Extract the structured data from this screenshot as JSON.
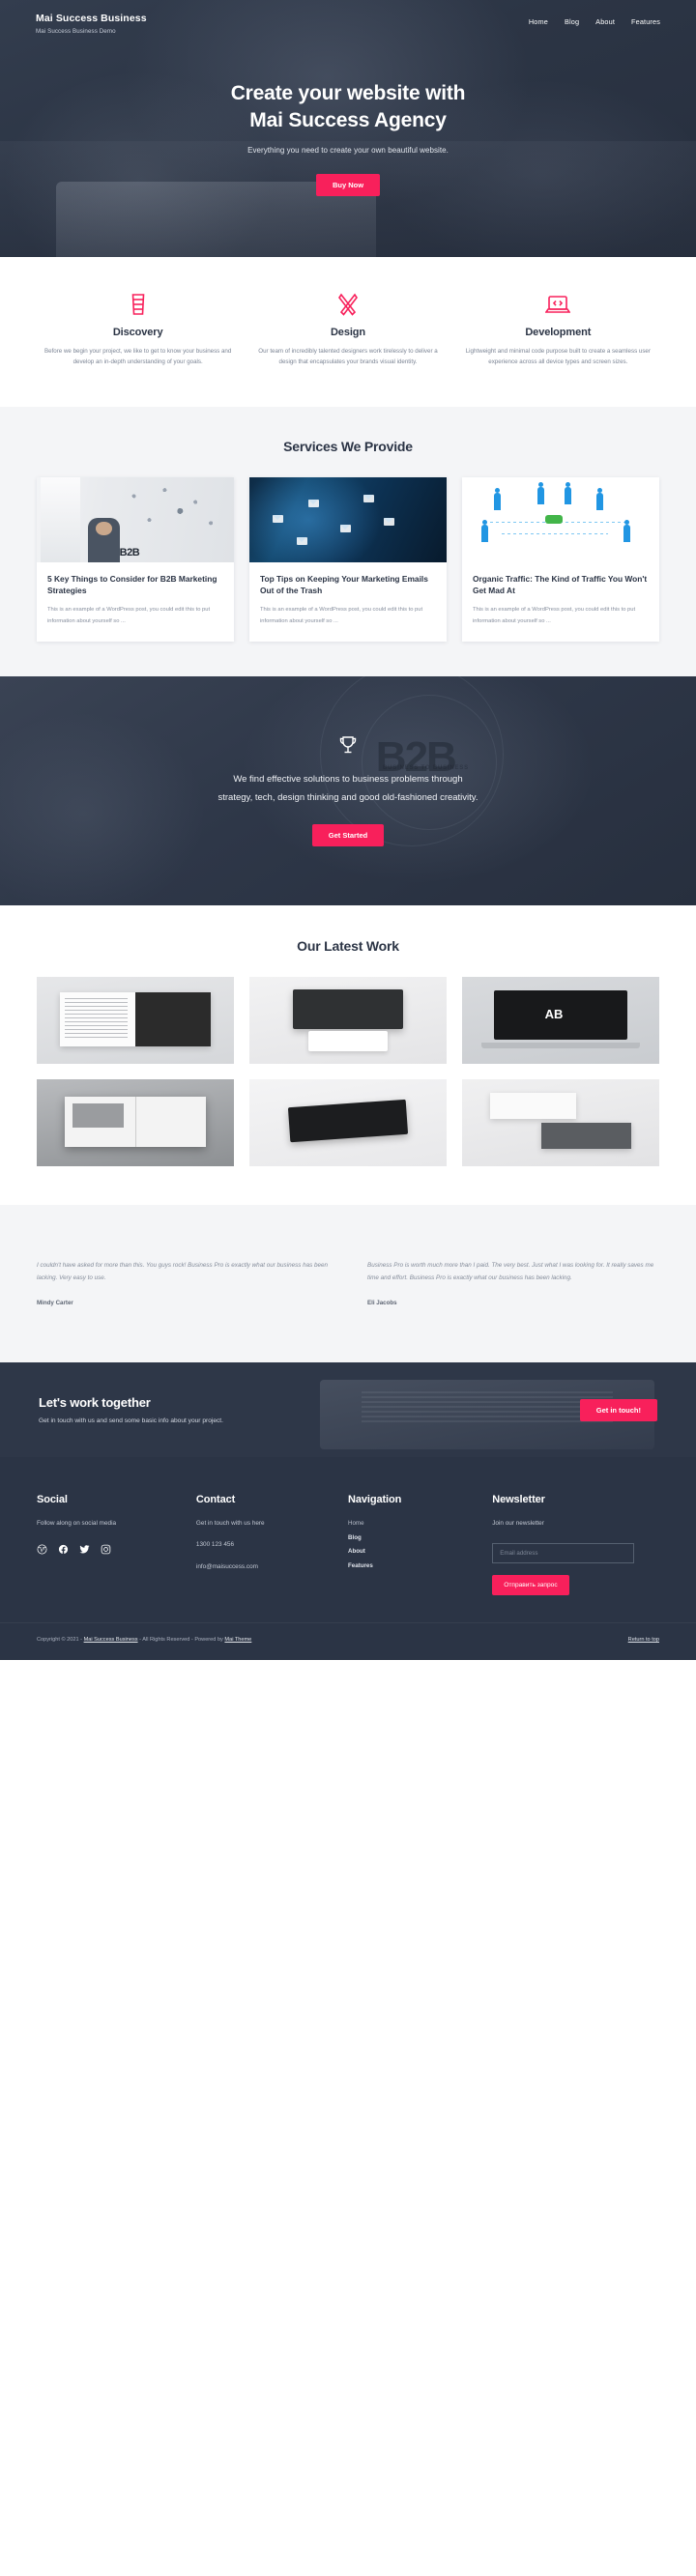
{
  "header": {
    "brand_title": "Mai Success Business",
    "brand_subtitle": "Mai Success Business Demo",
    "nav": [
      {
        "label": "Home"
      },
      {
        "label": "Blog"
      },
      {
        "label": "About"
      },
      {
        "label": "Features"
      }
    ]
  },
  "hero": {
    "title_line1": "Create your website with",
    "title_line2": "Mai Success Agency",
    "subtitle": "Everything you need to create your own beautiful website.",
    "button_label": "Buy Now"
  },
  "features": [
    {
      "icon": "coffee-cup-icon",
      "title": "Discovery",
      "text": "Before we begin your project, we like to get to know your business and develop an in-depth understanding of your goals."
    },
    {
      "icon": "pencil-ruler-icon",
      "title": "Design",
      "text": "Our team of incredibly talented designers work tirelessly to deliver a design that encapsulates your brands visual identity."
    },
    {
      "icon": "laptop-code-icon",
      "title": "Development",
      "text": "Lightweight and minimal code purpose built to create a seamless user experience across all device types and screen sizes."
    }
  ],
  "services": {
    "title": "Services We Provide",
    "cards": [
      {
        "image": "b2b-meeting-photo",
        "title": "5 Key Things to Consider for B2B Marketing Strategies",
        "text": "This is an example of a WordPress post, you could edit this to put information about yourself so ..."
      },
      {
        "image": "email-marketing-photo",
        "title": "Top Tips on Keeping Your Marketing Emails Out of the Trash",
        "text": "This is an example of a WordPress post, you could edit this to put information about yourself so ..."
      },
      {
        "image": "organic-traffic-network-photo",
        "title": "Organic Traffic: The Kind of Traffic You Won't Get Mad At",
        "text": "This is an example of a WordPress post, you could edit this to put information about yourself so ..."
      }
    ]
  },
  "cta": {
    "icon": "trophy-icon",
    "background_text": "B2B",
    "background_subtext": "BUSINESS TO BUSINESS",
    "line1": "We find effective solutions to business problems through",
    "line2": "strategy, tech, design thinking and good old-fashioned creativity.",
    "button_label": "Get Started"
  },
  "portfolio": {
    "title": "Our Latest Work",
    "tiles": [
      {
        "name": "open-magazine-mockup"
      },
      {
        "name": "dark-business-card-mockup"
      },
      {
        "name": "laptop-screen-mockup"
      },
      {
        "name": "grey-book-spread-mockup"
      },
      {
        "name": "black-card-mockup"
      },
      {
        "name": "stacked-cards-mockup"
      }
    ]
  },
  "testimonials": [
    {
      "quote": "I couldn't have asked for more than this. You guys rock! Business Pro is exactly what our business has been lacking. Very easy to use.",
      "author": "Mindy Carter"
    },
    {
      "quote": "Business Pro is worth much more than I paid. The very best. Just what I was looking for. It really saves me time and effort. Business Pro is exactly what our business has been lacking.",
      "author": "Eli Jacobs"
    }
  ],
  "together": {
    "title": "Let's work together",
    "subtitle": "Get in touch with us and send some basic info about your project.",
    "button_label": "Get in touch!"
  },
  "footer": {
    "social": {
      "heading": "Social",
      "text": "Follow along on social media",
      "icons": [
        {
          "name": "wordpress-icon"
        },
        {
          "name": "facebook-icon"
        },
        {
          "name": "twitter-icon"
        },
        {
          "name": "instagram-icon"
        }
      ]
    },
    "contact": {
      "heading": "Contact",
      "text": "Get in touch with us here",
      "phone": "1300 123 456",
      "email": "info@maisuccess.com"
    },
    "navigation": {
      "heading": "Navigation",
      "links": [
        {
          "label": "Home"
        },
        {
          "label": "Blog"
        },
        {
          "label": "About"
        },
        {
          "label": "Features"
        }
      ]
    },
    "newsletter": {
      "heading": "Newsletter",
      "text": "Join our newsletter",
      "input_placeholder": "Email address",
      "input_value": "",
      "button_label": "Отправить запрос"
    }
  },
  "copyright": {
    "prefix": "Copyright © 2021 - ",
    "site_link": "Mai Success Business",
    "middle": " - All Rights Reserved - Powered by ",
    "theme_link": "Mai Theme",
    "return_to_top": "Return to top"
  },
  "colors": {
    "accent": "#f8205b",
    "dark": "#2b3445",
    "light_bg": "#f4f5f7"
  }
}
